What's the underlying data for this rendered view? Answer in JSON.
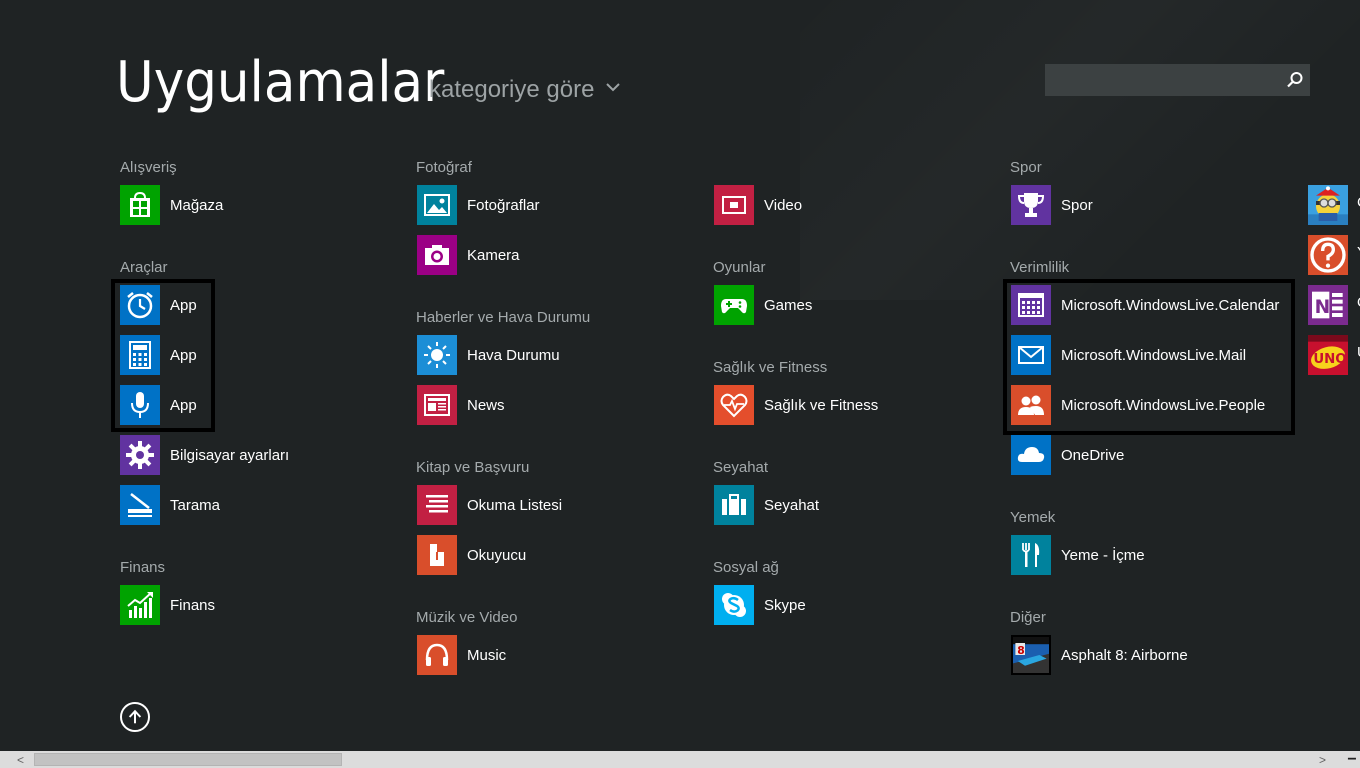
{
  "header": {
    "title": "Uygulamalar",
    "sort_label": "kategoriye göre",
    "search_placeholder": ""
  },
  "colors": {
    "background": "#1f2324",
    "store_green": "#00a300",
    "blue": "#0072c6",
    "purple": "#6133a0",
    "teal": "#00829d",
    "magenta": "#9b0085",
    "red": "#c22043",
    "orange": "#d94e2b"
  },
  "columns": {
    "c1": {
      "g1": "Alışveriş",
      "g2": "Araçlar",
      "g3": "Finans",
      "apps": {
        "magaza": {
          "label": "Mağaza",
          "icon": "store-icon"
        },
        "app_alarm": {
          "label": "App",
          "icon": "alarm-clock-icon"
        },
        "app_calc": {
          "label": "App",
          "icon": "calculator-icon"
        },
        "app_voice": {
          "label": "App",
          "icon": "microphone-icon"
        },
        "settings": {
          "label": "Bilgisayar ayarları",
          "icon": "gear-icon"
        },
        "scan": {
          "label": "Tarama",
          "icon": "scanner-icon"
        },
        "finance": {
          "label": "Finans",
          "icon": "finance-chart-icon"
        }
      }
    },
    "c2": {
      "g1": "Fotoğraf",
      "g2": "Haberler ve Hava Durumu",
      "g3": "Kitap ve Başvuru",
      "g4": "Müzik ve Video",
      "apps": {
        "photos": {
          "label": "Fotoğraflar",
          "icon": "photo-icon"
        },
        "camera": {
          "label": "Kamera",
          "icon": "camera-icon"
        },
        "weather": {
          "label": "Hava Durumu",
          "icon": "sun-icon"
        },
        "news": {
          "label": "News",
          "icon": "newspaper-icon"
        },
        "readlist": {
          "label": "Okuma Listesi",
          "icon": "reading-list-icon"
        },
        "reader": {
          "label": "Okuyucu",
          "icon": "reader-icon"
        },
        "music": {
          "label": "Music",
          "icon": "headphones-icon"
        }
      }
    },
    "c3": {
      "g1": "Oyunlar",
      "g2": "Sağlık ve Fitness",
      "g3": "Seyahat",
      "g4": "Sosyal ağ",
      "apps": {
        "video": {
          "label": "Video",
          "icon": "video-icon"
        },
        "games": {
          "label": "Games",
          "icon": "gamepad-icon"
        },
        "health": {
          "label": "Sağlık ve Fitness",
          "icon": "heart-pulse-icon"
        },
        "travel": {
          "label": "Seyahat",
          "icon": "suitcase-icon"
        },
        "skype": {
          "label": "Skype",
          "icon": "skype-icon"
        }
      }
    },
    "c4": {
      "g1": "Spor",
      "g2": "Verimlilik",
      "g3": "Yemek",
      "g4": "Diğer",
      "apps": {
        "sport": {
          "label": "Spor",
          "icon": "trophy-icon"
        },
        "calendar": {
          "label": "Microsoft.WindowsLive.Calendar",
          "icon": "calendar-icon"
        },
        "mail": {
          "label": "Microsoft.WindowsLive.Mail",
          "icon": "mail-icon"
        },
        "people": {
          "label": "Microsoft.WindowsLive.People",
          "icon": "people-icon"
        },
        "onedrive": {
          "label": "OneDrive",
          "icon": "cloud-icon"
        },
        "food": {
          "label": "Yeme - İçme",
          "icon": "fork-knife-icon"
        },
        "asphalt": {
          "label": "Asphalt 8: Airborne",
          "icon": "asphalt-game-icon"
        }
      }
    },
    "c5": {
      "apps": [
        {
          "label": "C",
          "icon": "minion-game-icon"
        },
        {
          "label": "Y",
          "icon": "help-icon"
        },
        {
          "label": "O",
          "icon": "onenote-icon"
        },
        {
          "label": "U",
          "icon": "uno-game-icon"
        }
      ]
    }
  },
  "scrollbar": {
    "left_arrow": "<",
    "right_arrow": ">",
    "minus": "−"
  }
}
